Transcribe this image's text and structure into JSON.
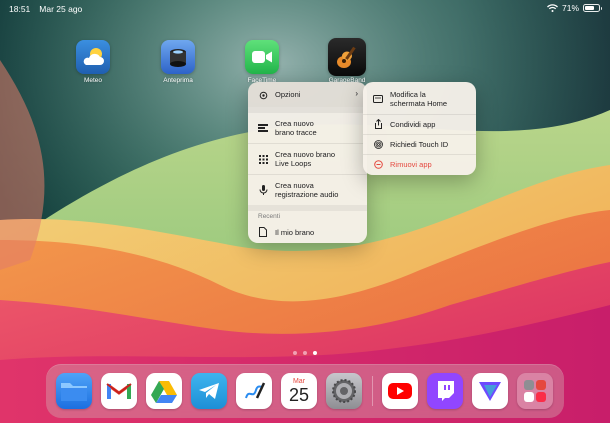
{
  "status_bar": {
    "time": "18:51",
    "date": "Mar 25 ago",
    "battery": "71%",
    "battery_level": 0.71
  },
  "home_apps": [
    {
      "label": "Meteo",
      "icon": "weather-icon"
    },
    {
      "label": "Anteprima",
      "icon": "preview-icon"
    },
    {
      "label": "FaceTime",
      "icon": "facetime-icon"
    },
    {
      "label": "GarageBand",
      "icon": "garageband-icon"
    }
  ],
  "context_menu": {
    "options": {
      "label": "Opzioni",
      "icon": "gear-icon"
    },
    "items": [
      {
        "label_line1": "Crea nuovo",
        "label_line2": "brano tracce",
        "icon": "tracks-icon"
      },
      {
        "label_line1": "Crea nuovo brano",
        "label_line2": "Live Loops",
        "icon": "grid-icon"
      },
      {
        "label_line1": "Crea nuova",
        "label_line2": "registrazione audio",
        "icon": "microphone-icon"
      }
    ],
    "recent_header": "Recenti",
    "recent_item": {
      "label": "Il mio brano",
      "icon": "document-icon"
    }
  },
  "submenu": {
    "items": [
      {
        "label_line1": "Modifica la",
        "label_line2": "schermata Home",
        "icon": "edit-home-icon"
      },
      {
        "label": "Condividi app",
        "icon": "share-icon"
      },
      {
        "label": "Richiedi Touch ID",
        "icon": "fingerprint-icon"
      },
      {
        "label": "Rimuovi app",
        "icon": "remove-icon",
        "color": "#e5483f"
      }
    ]
  },
  "page_indicator": {
    "pages": 3,
    "current": 3
  },
  "dock": {
    "apps": [
      {
        "name": "Files",
        "icon": "files-icon"
      },
      {
        "name": "Gmail",
        "icon": "gmail-icon"
      },
      {
        "name": "Google Drive",
        "icon": "google-drive-icon"
      },
      {
        "name": "Telegram",
        "icon": "telegram-icon"
      },
      {
        "name": "Freeform",
        "icon": "freeform-icon"
      },
      {
        "name": "Calendar",
        "icon": "calendar-icon",
        "month": "Mar",
        "day": "25"
      },
      {
        "name": "Settings",
        "icon": "settings-icon"
      },
      {
        "name": "YouTube",
        "icon": "youtube-icon"
      },
      {
        "name": "Twitch",
        "icon": "twitch-icon"
      },
      {
        "name": "Proton VPN",
        "icon": "vpn-icon"
      },
      {
        "name": "Recent apps",
        "icon": "app-library-icon"
      }
    ]
  },
  "colors": {
    "remove_red": "#e5483f",
    "menu_bg": "#f6f0e9"
  }
}
